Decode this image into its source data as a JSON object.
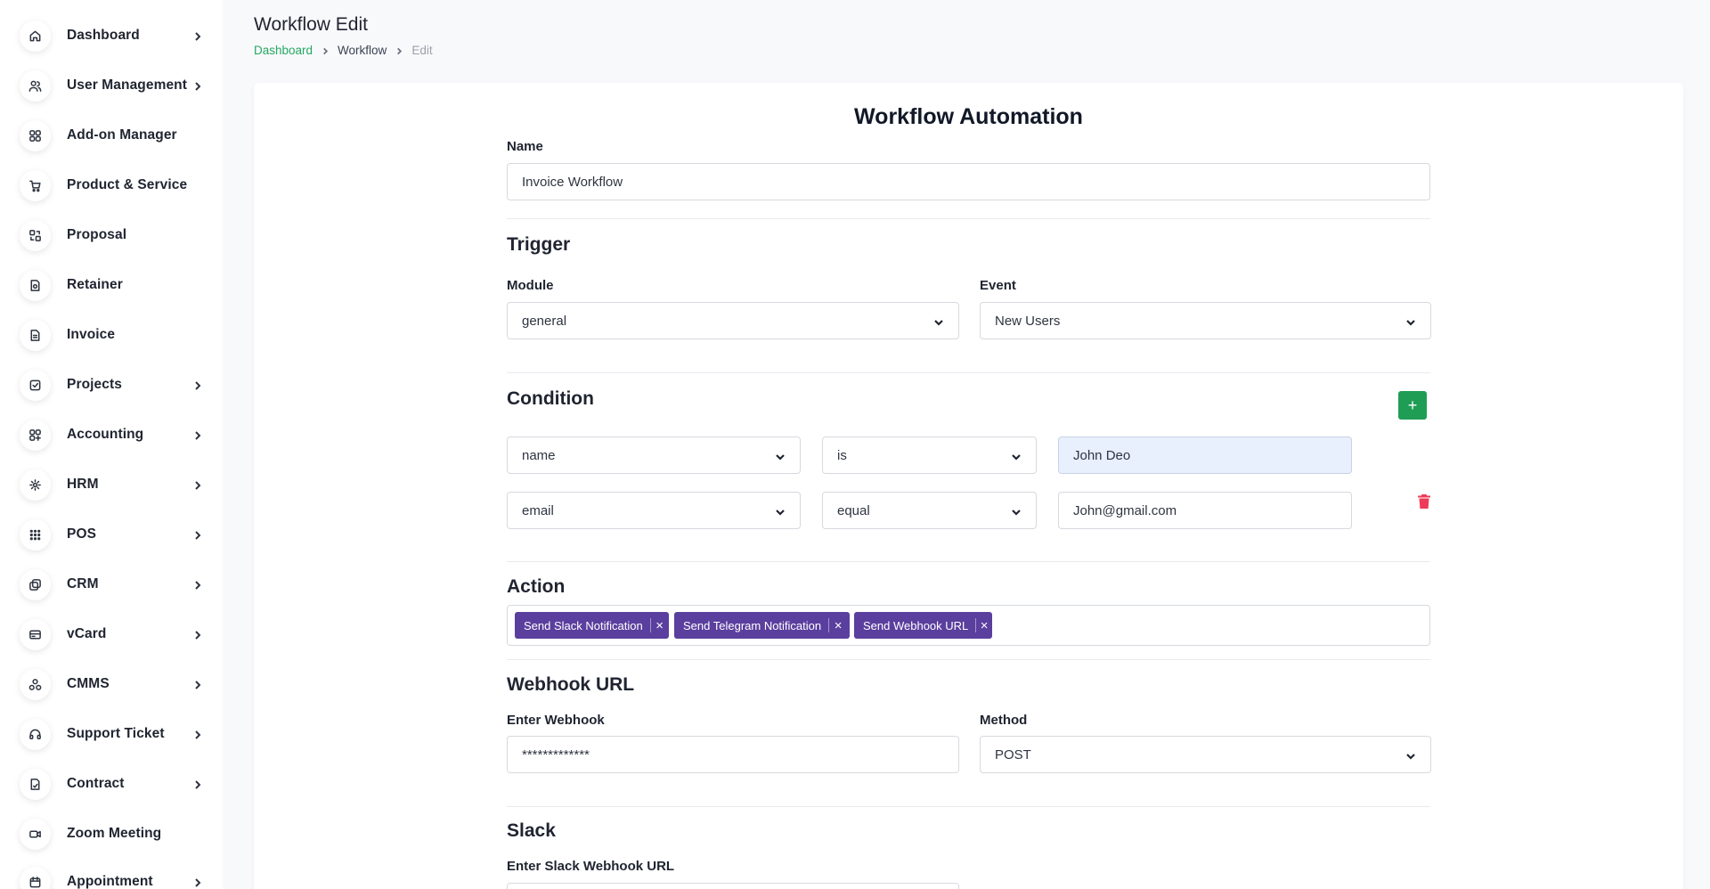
{
  "sidebar": {
    "items": [
      {
        "label": "Dashboard",
        "icon": "home-icon",
        "has_submenu": true
      },
      {
        "label": "User Management",
        "icon": "users-icon",
        "has_submenu": true
      },
      {
        "label": "Add-on Manager",
        "icon": "grid-icon",
        "has_submenu": false
      },
      {
        "label": "Product & Service",
        "icon": "cart-icon",
        "has_submenu": false
      },
      {
        "label": "Proposal",
        "icon": "proposal-icon",
        "has_submenu": false
      },
      {
        "label": "Retainer",
        "icon": "retainer-icon",
        "has_submenu": false
      },
      {
        "label": "Invoice",
        "icon": "invoice-icon",
        "has_submenu": false
      },
      {
        "label": "Projects",
        "icon": "check-square-icon",
        "has_submenu": true
      },
      {
        "label": "Accounting",
        "icon": "apps-icon",
        "has_submenu": true
      },
      {
        "label": "HRM",
        "icon": "hrm-icon",
        "has_submenu": true
      },
      {
        "label": "POS",
        "icon": "dots-grid-icon",
        "has_submenu": true
      },
      {
        "label": "CRM",
        "icon": "crm-icon",
        "has_submenu": true
      },
      {
        "label": "vCard",
        "icon": "card-icon",
        "has_submenu": true
      },
      {
        "label": "CMMS",
        "icon": "cmms-icon",
        "has_submenu": true
      },
      {
        "label": "Support Ticket",
        "icon": "headset-icon",
        "has_submenu": true
      },
      {
        "label": "Contract",
        "icon": "contract-icon",
        "has_submenu": true
      },
      {
        "label": "Zoom Meeting",
        "icon": "video-icon",
        "has_submenu": false
      },
      {
        "label": "Appointment",
        "icon": "calendar-icon",
        "has_submenu": true
      }
    ]
  },
  "header": {
    "title": "Workflow Edit",
    "breadcrumb": [
      "Dashboard",
      "Workflow",
      "Edit"
    ]
  },
  "form": {
    "title": "Workflow Automation",
    "name_label": "Name",
    "name_value": "Invoice Workflow",
    "trigger": {
      "title": "Trigger",
      "module_label": "Module",
      "module_value": "general",
      "event_label": "Event",
      "event_value": "New Users"
    },
    "condition": {
      "title": "Condition",
      "add_label": "+",
      "rows": [
        {
          "field": "name",
          "operator": "is",
          "value": "John Deo"
        },
        {
          "field": "email",
          "operator": "equal",
          "value": "John@gmail.com"
        }
      ]
    },
    "action": {
      "title": "Action",
      "tags": [
        "Send Slack Notification",
        "Send Telegram Notification",
        "Send Webhook URL"
      ],
      "remove_glyph": "×",
      "tag_color": "#5b3f9e"
    },
    "webhook": {
      "title": "Webhook URL",
      "url_label": "Enter Webhook",
      "url_value": "*************",
      "method_label": "Method",
      "method_value": "POST"
    },
    "slack": {
      "title": "Slack",
      "url_label": "Enter Slack Webhook URL"
    }
  },
  "colors": {
    "accent": "#24a862",
    "add_button": "#1f9d55",
    "delete": "#ee3b57",
    "filled_input": "#e8effd"
  }
}
